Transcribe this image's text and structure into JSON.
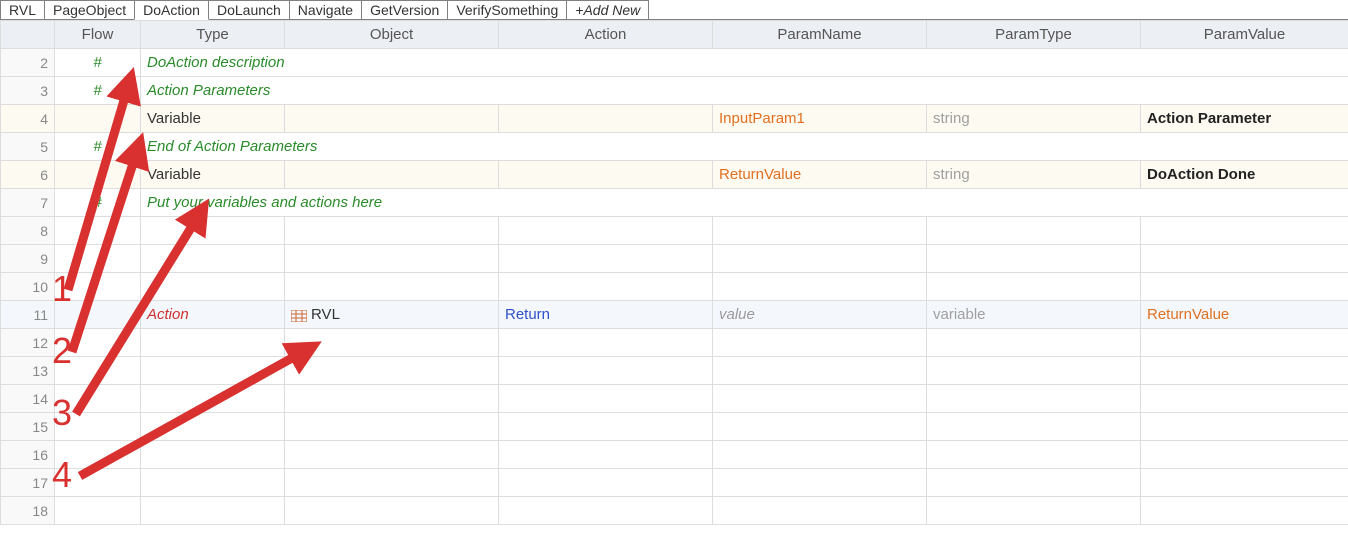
{
  "tabs": [
    {
      "label": "RVL",
      "active": false
    },
    {
      "label": "PageObject",
      "active": false
    },
    {
      "label": "DoAction",
      "active": true
    },
    {
      "label": "DoLaunch",
      "active": false
    },
    {
      "label": "Navigate",
      "active": false
    },
    {
      "label": "GetVersion",
      "active": false
    },
    {
      "label": "VerifySomething",
      "active": false
    },
    {
      "label": "+Add New",
      "active": false,
      "addnew": true
    }
  ],
  "headers": {
    "flow": "Flow",
    "type": "Type",
    "object": "Object",
    "action": "Action",
    "param_name": "ParamName",
    "param_type": "ParamType",
    "param_value": "ParamValue"
  },
  "rows": [
    {
      "n": "2",
      "flow": "#",
      "type": "DoAction description",
      "style": "comment"
    },
    {
      "n": "3",
      "flow": "#",
      "type": "Action Parameters",
      "style": "comment"
    },
    {
      "n": "4",
      "flow": "",
      "type": "Variable",
      "param_name": "InputParam1",
      "param_type": "string",
      "param_value": "Action Parameter",
      "highlight": true
    },
    {
      "n": "5",
      "flow": "#",
      "type": "End of Action Parameters",
      "style": "comment"
    },
    {
      "n": "6",
      "flow": "",
      "type": "Variable",
      "param_name": "ReturnValue",
      "param_type": "string",
      "param_value": "DoAction Done",
      "highlight": true
    },
    {
      "n": "7",
      "flow": "#",
      "type": "Put your variables and actions here",
      "style": "comment"
    },
    {
      "n": "8"
    },
    {
      "n": "9"
    },
    {
      "n": "10"
    },
    {
      "n": "11",
      "flow": "",
      "type": "Action",
      "object": "RVL",
      "object_icon": true,
      "action": "Return",
      "param_name": "value",
      "param_type": "variable",
      "param_value": "ReturnValue",
      "action_row": true
    },
    {
      "n": "12"
    },
    {
      "n": "13"
    },
    {
      "n": "14"
    },
    {
      "n": "15"
    },
    {
      "n": "16"
    },
    {
      "n": "17"
    },
    {
      "n": "18"
    }
  ],
  "annotations": {
    "1": "1",
    "2": "2",
    "3": "3",
    "4": "4"
  }
}
